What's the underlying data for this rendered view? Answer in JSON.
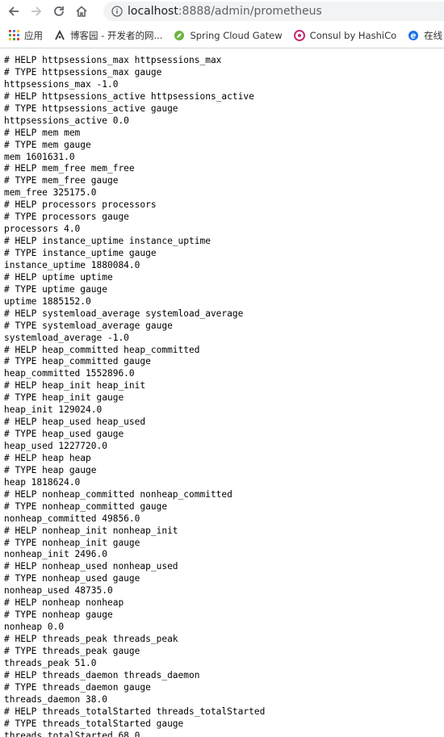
{
  "browser": {
    "url_host": "localhost",
    "url_path": ":8888/admin/prometheus"
  },
  "bookmarks": [
    {
      "label": "应用",
      "icon": "apps-grid-icon"
    },
    {
      "label": "博客园 - 开发者的网...",
      "icon": "cnblogs-icon"
    },
    {
      "label": "Spring Cloud Gatew",
      "icon": "spring-leaf-icon"
    },
    {
      "label": "Consul by HashiCo",
      "icon": "consul-icon"
    },
    {
      "label": "在线",
      "icon": "globe-e-icon"
    }
  ],
  "lines": [
    "# HELP httpsessions_max httpsessions_max",
    "# TYPE httpsessions_max gauge",
    "httpsessions_max -1.0",
    "# HELP httpsessions_active httpsessions_active",
    "# TYPE httpsessions_active gauge",
    "httpsessions_active 0.0",
    "# HELP mem mem",
    "# TYPE mem gauge",
    "mem 1601631.0",
    "# HELP mem_free mem_free",
    "# TYPE mem_free gauge",
    "mem_free 325175.0",
    "# HELP processors processors",
    "# TYPE processors gauge",
    "processors 4.0",
    "# HELP instance_uptime instance_uptime",
    "# TYPE instance_uptime gauge",
    "instance_uptime 1880084.0",
    "# HELP uptime uptime",
    "# TYPE uptime gauge",
    "uptime 1885152.0",
    "# HELP systemload_average systemload_average",
    "# TYPE systemload_average gauge",
    "systemload_average -1.0",
    "# HELP heap_committed heap_committed",
    "# TYPE heap_committed gauge",
    "heap_committed 1552896.0",
    "# HELP heap_init heap_init",
    "# TYPE heap_init gauge",
    "heap_init 129024.0",
    "# HELP heap_used heap_used",
    "# TYPE heap_used gauge",
    "heap_used 1227720.0",
    "# HELP heap heap",
    "# TYPE heap gauge",
    "heap 1818624.0",
    "# HELP nonheap_committed nonheap_committed",
    "# TYPE nonheap_committed gauge",
    "nonheap_committed 49856.0",
    "# HELP nonheap_init nonheap_init",
    "# TYPE nonheap_init gauge",
    "nonheap_init 2496.0",
    "# HELP nonheap_used nonheap_used",
    "# TYPE nonheap_used gauge",
    "nonheap_used 48735.0",
    "# HELP nonheap nonheap",
    "# TYPE nonheap gauge",
    "nonheap 0.0",
    "# HELP threads_peak threads_peak",
    "# TYPE threads_peak gauge",
    "threads_peak 51.0",
    "# HELP threads_daemon threads_daemon",
    "# TYPE threads_daemon gauge",
    "threads_daemon 38.0",
    "# HELP threads_totalStarted threads_totalStarted",
    "# TYPE threads_totalStarted gauge",
    "threads_totalStarted 68.0"
  ]
}
